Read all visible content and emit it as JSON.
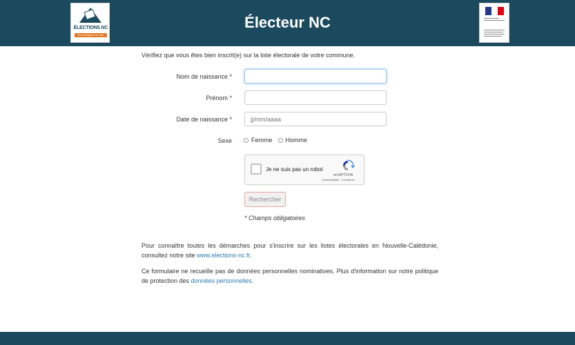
{
  "header": {
    "title": "Électeur NC",
    "left_logo": {
      "brand": "ÉLECTIONS NC",
      "tagline": "Pour préparer le vote",
      "icon": "ballot-box-icon"
    },
    "right_logo": {
      "icon": "marianne-flag-icon",
      "colors": [
        "#1f3a8f",
        "#ffffff",
        "#e1000f"
      ]
    }
  },
  "form": {
    "intro": "Vérifiez que vous êtes bien inscrit(e) sur la liste électorale de votre commune.",
    "birth_name_label": "Nom de naissance *",
    "birth_name_value": "",
    "first_name_label": "Prénom *",
    "first_name_value": "",
    "birth_date_label": "Date de naissance *",
    "birth_date_placeholder": "jj/mm/aaaa",
    "sex_label": "Sexe",
    "sex_options": [
      "Femme",
      "Homme"
    ],
    "captcha": {
      "label": "Je ne suis pas un robot",
      "brand": "reCAPTCHA",
      "links": "Confidentialité - Conditions"
    },
    "search_button": "Rechercher",
    "required_note": "* Champs obligatoires"
  },
  "info": {
    "p1_text": "Pour connaître toutes les démarches pour s'inscrire sur les listes électorales en Nouvelle-Calédonie, consultez notre site ",
    "p1_link": "www.elections-nc.fr",
    "p1_end": ".",
    "p2_text": "Ce formulaire ne recueille pas de données personnelles nominatives. Plus d'information sur notre politique de protection des ",
    "p2_link": "données personnelles",
    "p2_end": "."
  },
  "colors": {
    "header_bg": "#1b4a5e",
    "link": "#2a7ab0",
    "button_border": "#e6a79a"
  }
}
